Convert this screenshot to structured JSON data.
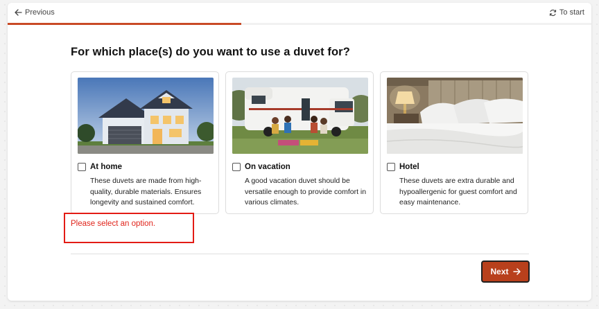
{
  "nav": {
    "previous_label": "Previous",
    "to_start_label": "To start",
    "progress_fraction": 0.4
  },
  "question": "For which place(s) do you want to use a duvet for?",
  "options": [
    {
      "title": "At home",
      "description": "These duvets are made from high-quality, durable materials. Ensures longevity and sustained comfort.",
      "checked": false,
      "image": "house-photo"
    },
    {
      "title": "On vacation",
      "description": "A good vacation duvet should be versatile enough to provide comfort in various climates.",
      "checked": false,
      "image": "camper-photo"
    },
    {
      "title": "Hotel",
      "description": "These duvets are extra durable and hypoallergenic for guest comfort and easy maintenance.",
      "checked": false,
      "image": "hotel-bed-photo"
    }
  ],
  "error_message": "Please select an option.",
  "next_label": "Next",
  "colors": {
    "accent": "#b8401c",
    "error": "#e0241b",
    "progress": "#c94a26"
  }
}
